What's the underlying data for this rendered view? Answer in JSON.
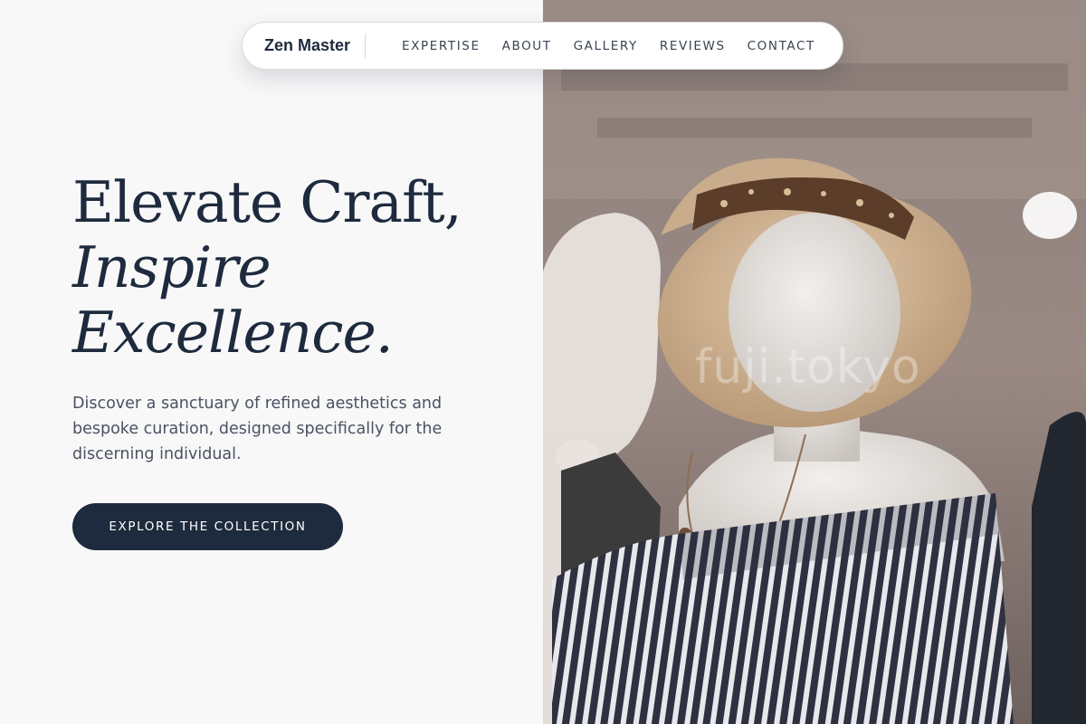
{
  "brand": "Zen Master",
  "nav": {
    "items": [
      "EXPERTISE",
      "ABOUT",
      "GALLERY",
      "REVIEWS",
      "CONTACT"
    ]
  },
  "hero": {
    "line1": "Elevate Craft,",
    "line2": "Inspire",
    "line3": "Excellence.",
    "description": "Discover a sanctuary of refined aesthetics and bespoke curation, designed specifically for the discerning individual.",
    "cta_label": "EXPLORE THE COLLECTION"
  },
  "image": {
    "watermark": "fuji.tokyo",
    "subject": "mannequin-hat-photo"
  },
  "colors": {
    "navy": "#1e2a3d",
    "background": "#f8f8f9"
  }
}
